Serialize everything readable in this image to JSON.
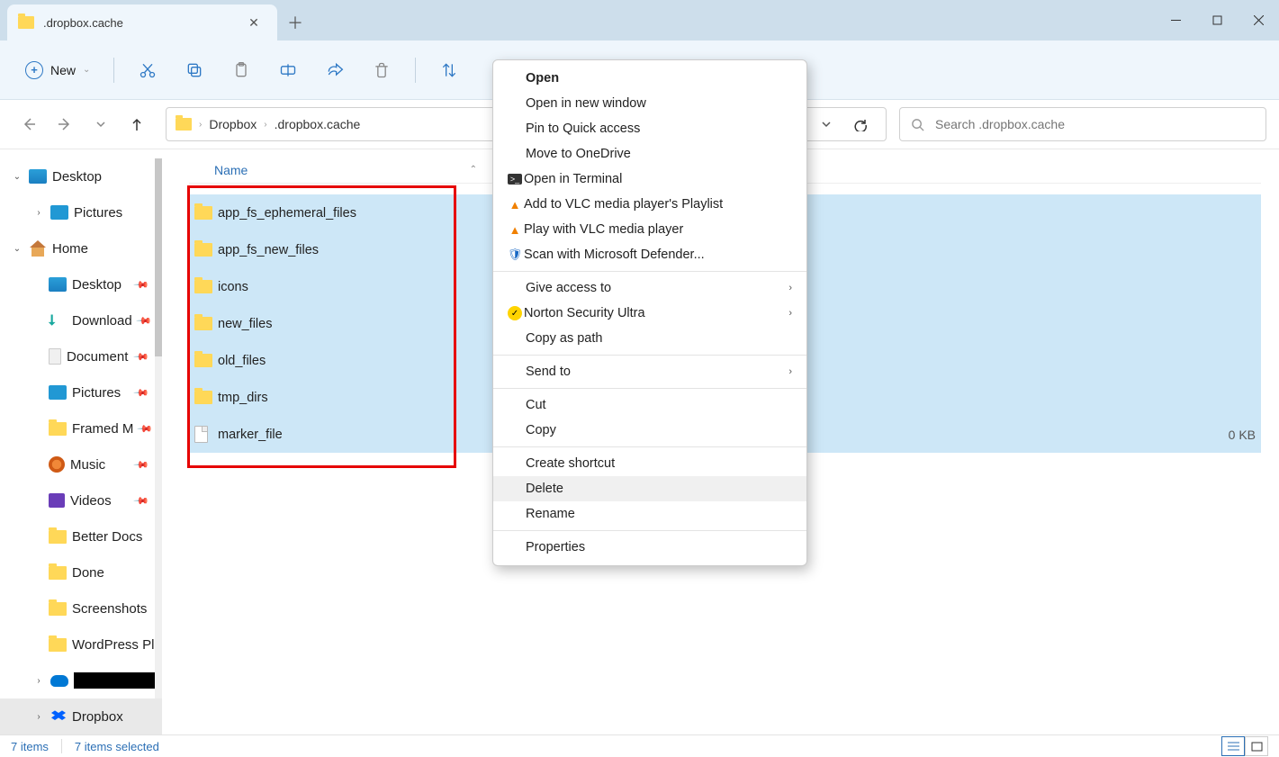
{
  "tab": {
    "title": ".dropbox.cache"
  },
  "toolbar": {
    "new_label": "New"
  },
  "breadcrumb": {
    "seg1": "Dropbox",
    "seg2": ".dropbox.cache"
  },
  "search": {
    "placeholder": "Search .dropbox.cache"
  },
  "sidebar": {
    "desktop": "Desktop",
    "pictures": "Pictures",
    "home": "Home",
    "home_desktop": "Desktop",
    "downloads": "Download",
    "documents": "Document",
    "home_pictures": "Pictures",
    "framed": "Framed M",
    "music": "Music",
    "videos": "Videos",
    "betterdocs": "Better Docs",
    "done": "Done",
    "screenshots": "Screenshots",
    "wordpress": "WordPress Pl",
    "dropbox": "Dropbox"
  },
  "columns": {
    "name": "Name"
  },
  "files": {
    "f0": "app_fs_ephemeral_files",
    "f1": "app_fs_new_files",
    "f2": "icons",
    "f3": "new_files",
    "f4": "old_files",
    "f5": "tmp_dirs",
    "f6": "marker_file",
    "f6_size": "0 KB"
  },
  "context": {
    "open": "Open",
    "open_new": "Open in new window",
    "pin": "Pin to Quick access",
    "onedrive": "Move to OneDrive",
    "terminal": "Open in Terminal",
    "vlc_add": "Add to VLC media player's Playlist",
    "vlc_play": "Play with VLC media player",
    "defender": "Scan with Microsoft Defender...",
    "give_access": "Give access to",
    "norton": "Norton Security Ultra",
    "copy_path": "Copy as path",
    "send_to": "Send to",
    "cut": "Cut",
    "copy": "Copy",
    "shortcut": "Create shortcut",
    "delete": "Delete",
    "rename": "Rename",
    "properties": "Properties"
  },
  "status": {
    "count": "7 items",
    "selected": "7 items selected"
  }
}
